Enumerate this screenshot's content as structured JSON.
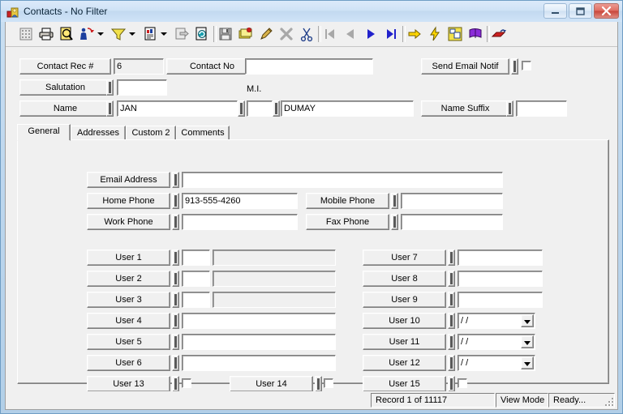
{
  "window": {
    "title": "Contacts - No Filter",
    "icon": "contacts-card-icon",
    "minimize_label": "Minimize",
    "maximize_label": "Maximize",
    "close_label": "Close"
  },
  "toolbar": {
    "buttons": [
      {
        "name": "grid-view-icon",
        "tip": "Grid View"
      },
      {
        "name": "print-icon",
        "tip": "Print"
      },
      {
        "name": "print-preview-icon",
        "tip": "Print Preview"
      },
      {
        "name": "find-icon",
        "tip": "Find"
      },
      {
        "name": "filter-icon",
        "tip": "Filter"
      },
      {
        "name": "report-icon",
        "tip": "Report"
      },
      {
        "name": "export-icon",
        "tip": "Export"
      },
      {
        "name": "refresh-record-icon",
        "tip": "Refresh"
      },
      {
        "name": "save-icon",
        "tip": "Save"
      },
      {
        "name": "new-record-icon",
        "tip": "New"
      },
      {
        "name": "edit-icon",
        "tip": "Edit"
      },
      {
        "name": "delete-icon",
        "tip": "Delete"
      },
      {
        "name": "cut-icon",
        "tip": "Cut"
      },
      {
        "name": "first-record-icon",
        "tip": "First Record"
      },
      {
        "name": "previous-record-icon",
        "tip": "Previous Record"
      },
      {
        "name": "next-record-icon",
        "tip": "Next Record"
      },
      {
        "name": "last-record-icon",
        "tip": "Last Record"
      },
      {
        "name": "goto-icon",
        "tip": "Go To"
      },
      {
        "name": "quick-action-icon",
        "tip": "Quick Action"
      },
      {
        "name": "layout-icon",
        "tip": "Layout"
      },
      {
        "name": "help-book-icon",
        "tip": "Help"
      },
      {
        "name": "exit-icon",
        "tip": "Exit"
      }
    ]
  },
  "header": {
    "contact_rec_label": "Contact Rec #",
    "contact_rec_value": "6",
    "contact_no_label": "Contact No",
    "contact_no_value": "",
    "send_email_label": "Send Email Notif",
    "send_email_checked": false,
    "salutation_label": "Salutation",
    "salutation_value": "",
    "name_label": "Name",
    "first_name_value": "JAN",
    "mi_label": "M.I.",
    "mi_value": "",
    "last_name_value": "DUMAY",
    "name_suffix_label": "Name Suffix",
    "name_suffix_value": ""
  },
  "tabs": [
    {
      "label": "General",
      "active": true
    },
    {
      "label": "Addresses",
      "active": false
    },
    {
      "label": "Custom 2",
      "active": false
    },
    {
      "label": "Comments",
      "active": false
    }
  ],
  "contact_fields": [
    {
      "label": "Email Address",
      "value": ""
    },
    {
      "label": "Home Phone",
      "value": "913-555-4260"
    },
    {
      "label": "Mobile Phone",
      "value": ""
    },
    {
      "label": "Work Phone",
      "value": ""
    },
    {
      "label": "Fax Phone",
      "value": ""
    }
  ],
  "user_fields_left": [
    {
      "label": "User 1",
      "code": "",
      "desc": "",
      "type": "code-desc"
    },
    {
      "label": "User 2",
      "code": "",
      "desc": "",
      "type": "code-desc"
    },
    {
      "label": "User 3",
      "code": "",
      "desc": "",
      "type": "code-desc"
    },
    {
      "label": "User 4",
      "value": "",
      "type": "text"
    },
    {
      "label": "User 5",
      "value": "",
      "type": "text"
    },
    {
      "label": "User 6",
      "value": "",
      "type": "text"
    }
  ],
  "user_fields_right": [
    {
      "label": "User 7",
      "value": "",
      "type": "text"
    },
    {
      "label": "User 8",
      "value": "",
      "type": "text"
    },
    {
      "label": "User 9",
      "value": "",
      "type": "text"
    },
    {
      "label": "User 10",
      "value": "/  /",
      "type": "date"
    },
    {
      "label": "User 11",
      "value": "/  /",
      "type": "date"
    },
    {
      "label": "User 12",
      "value": "/  /",
      "type": "date"
    }
  ],
  "user_fields_check": [
    {
      "label": "User 13",
      "checked": false
    },
    {
      "label": "User 14",
      "checked": false
    },
    {
      "label": "User 15",
      "checked": false
    }
  ],
  "statusbar": {
    "record": "Record 1 of 11117",
    "mode": "View Mode",
    "state": "Ready..."
  },
  "colors": {
    "face": "#f0f0f0",
    "field": "#ffffff",
    "title_accent": "#b2cfe8",
    "close_red": "#c8453a",
    "nav_blue": "#2222cc",
    "arrow_yellow": "#ffd700"
  }
}
